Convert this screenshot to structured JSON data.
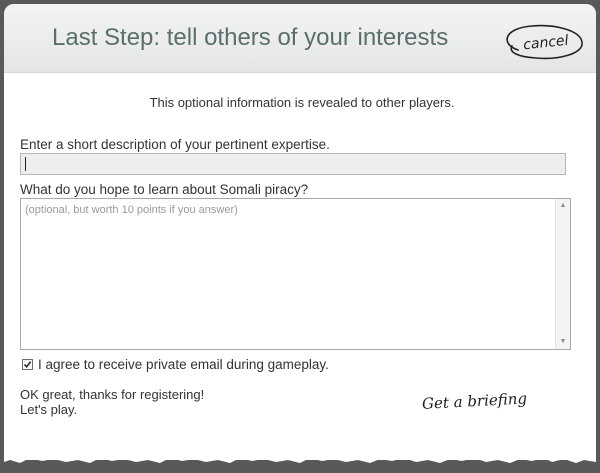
{
  "header": {
    "title": "Last Step: tell others of your interests",
    "cancel_label": "cancel"
  },
  "intro": "This optional information is revealed to other players.",
  "expertise": {
    "label": "Enter a short description of your pertinent expertise.",
    "value": ""
  },
  "learn": {
    "label": "What do you hope to learn about Somali piracy?",
    "placeholder": "(optional, but worth 10 points if you answer)"
  },
  "email_opt_in": {
    "label": "I agree to receive private email during gameplay.",
    "checked": true
  },
  "closing": {
    "line1": "OK great, thanks for registering!",
    "line2": "Let's play."
  },
  "briefing_label": "Get a briefing",
  "colors": {
    "title": "#5a6e6e",
    "header_bg": "#e8eae8",
    "backdrop": "#595959"
  }
}
